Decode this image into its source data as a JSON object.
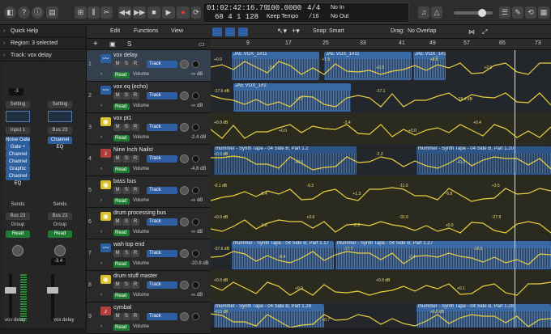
{
  "transport": {
    "time": "01:02:42:16.79",
    "bars": "68  4  1  128",
    "tempo": "100.0000",
    "tempo_mode": "Keep Tempo",
    "sig_top": "4/4",
    "sig_bottom": "/16",
    "in": "No In",
    "out": "No Out"
  },
  "inspector": {
    "quick_help": "Quick Help",
    "region": "Region: 3 selected",
    "track": "Track:  vox delay"
  },
  "strips": [
    {
      "name": "vox delay",
      "setting": "Setting",
      "input": "Input 1",
      "plugins": [
        "Noise Gate",
        "Gate +",
        "Channel EQ",
        "Channel EQ",
        "Graphic EQ",
        "Channel EQ"
      ],
      "sends": "Sends",
      "bus": "Bus 23",
      "group": "Group",
      "read": "Read",
      "value": "-3"
    },
    {
      "name": "vox delay",
      "setting": "Setting",
      "input": "Bus 23",
      "plugins": [
        "Channel EQ"
      ],
      "sends": "Sends",
      "bus": "Bus 23",
      "group": "Group",
      "read": "Read",
      "value": "-3.4"
    }
  ],
  "toolbar": {
    "edit": "Edit",
    "functions": "Functions",
    "view": "View",
    "snap_label": "Snap:",
    "snap": "Smart",
    "drag_label": "Drag:",
    "drag": "No Overlap"
  },
  "ruler": [
    "9",
    "17",
    "25",
    "33",
    "41",
    "49",
    "57",
    "65",
    "73"
  ],
  "tracks": [
    {
      "num": "1",
      "name": "vox delay",
      "icon": "waveform-icon",
      "btn": "Track",
      "read": "Read",
      "param": "Volume",
      "val": "-∞ dB",
      "sel": true
    },
    {
      "num": "2",
      "name": "vox eq (echo)",
      "icon": "waveform-icon",
      "btn": "Track",
      "read": "Read",
      "param": "Volume",
      "val": "-∞ dB",
      "sel": false
    },
    {
      "num": "3",
      "name": "vox pt1",
      "icon": "bus-icon",
      "btn": "Track",
      "read": "Read",
      "param": "Volume",
      "val": "-2.4 dB",
      "sel": false
    },
    {
      "num": "4",
      "name": "Nine Inch Nails!",
      "icon": "keyboard-icon",
      "btn": "Track",
      "read": "Read",
      "param": "Volume",
      "val": "-4.8 dB",
      "sel": false
    },
    {
      "num": "5",
      "name": "bass bus",
      "icon": "bus-icon",
      "btn": "Track",
      "read": "Read",
      "param": "Volume",
      "val": "-∞ dB",
      "sel": false
    },
    {
      "num": "6",
      "name": "drum processing bus",
      "icon": "bus-icon",
      "btn": "Track",
      "read": "Read",
      "param": "Volume",
      "val": "-∞ dB",
      "sel": false
    },
    {
      "num": "7",
      "name": "wah top end",
      "icon": "waveform-icon",
      "btn": "Track",
      "read": "Read",
      "param": "Volume",
      "val": "-20.8 dB",
      "sel": false
    },
    {
      "num": "8",
      "name": "drum stuff master",
      "icon": "bus-icon",
      "btn": "Track",
      "read": "Read",
      "param": "Volume",
      "val": "-∞ dB",
      "sel": false
    },
    {
      "num": "9",
      "name": "cymbal",
      "icon": "keyboard-icon",
      "btn": "Track",
      "read": "Read",
      "param": "Volume",
      "val": "",
      "sel": false
    }
  ],
  "regions": [
    {
      "lane": 0,
      "label": "JAE VOX_1#11",
      "dark": false
    },
    {
      "lane": 0,
      "label": "JAE VOX_1#11",
      "dark": false
    },
    {
      "lane": 0,
      "label": "JAE VOX_1#11",
      "dark": false
    },
    {
      "lane": 1,
      "label": "JAE VOX_1#2",
      "dark": false
    },
    {
      "lane": 3,
      "label": "mummer - Synth Tape - 04 Side B, Part 1.2",
      "dark": true
    },
    {
      "lane": 3,
      "label": "mummer - Synth Tape - 04 Side B, Part 1.20",
      "dark": true
    },
    {
      "lane": 6,
      "label": "mummer - Synth Tape - 04 Side B, Part 1.17",
      "dark": false
    },
    {
      "lane": 6,
      "label": "mummer - Synth Tape - 04 Side B, Part 1.27",
      "dark": false
    },
    {
      "lane": 8,
      "label": "mummer - Synth Tape - 04 Side B, Part 1.28",
      "dark": false
    },
    {
      "lane": 8,
      "label": "mummer - Synth Tape - 04 Side B, Part 1.28",
      "dark": false
    }
  ],
  "automation": [
    {
      "lane": 0,
      "labels": [
        "+0.0",
        "-2.7",
        "+1.5",
        "+2.3",
        "+8.8",
        "+2.0"
      ]
    },
    {
      "lane": 1,
      "labels": [
        "-17.6 dB",
        "+7.7",
        "-17.1",
        "-19.4 dB"
      ]
    },
    {
      "lane": 2,
      "labels": [
        "+0.0 dB",
        "+0.0",
        "-3.4",
        "+0.0",
        "+0.4"
      ]
    },
    {
      "lane": 3,
      "labels": [
        "+0.0 dB",
        "+0.0",
        "-2.3",
        "+0.0"
      ]
    },
    {
      "lane": 4,
      "labels": [
        "-0.1 dB",
        "-5.4",
        "-9.3",
        "+1.3",
        "-11.0",
        "-6.8",
        "+3.5"
      ]
    },
    {
      "lane": 5,
      "labels": [
        "+0.0 dB",
        "-0.8",
        "+0.6",
        "-2.9",
        "-31.6",
        "+0.0",
        "-27.9"
      ]
    },
    {
      "lane": 6,
      "labels": [
        "-37.6 dB",
        "-6.4",
        "-17.7",
        "-7.4",
        "-16.5"
      ]
    },
    {
      "lane": 7,
      "labels": [
        "+0.0 dB",
        "+0.0",
        "+0.0 dB",
        "+0.1"
      ]
    },
    {
      "lane": 8,
      "labels": [
        "+0.0 dB",
        "+0.7",
        "+0.0 dB"
      ]
    }
  ]
}
